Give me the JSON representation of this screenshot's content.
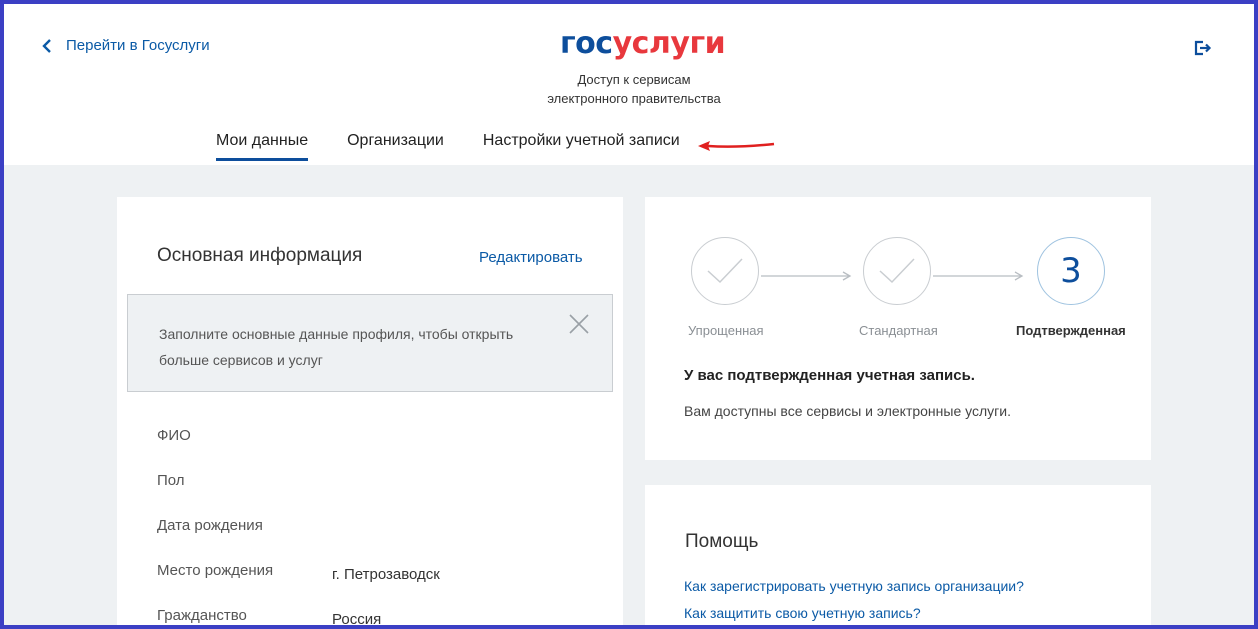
{
  "header": {
    "back_label": "Перейти в Госуслуги",
    "logo_part1": "гос",
    "logo_part2": "услуги",
    "tagline_line1": "Доступ к сервисам",
    "tagline_line2": "электронного правительства",
    "tabs": [
      {
        "label": "Мои данные",
        "active": true
      },
      {
        "label": "Организации",
        "active": false
      },
      {
        "label": "Настройки учетной записи",
        "active": false
      }
    ]
  },
  "main_info": {
    "title": "Основная информация",
    "edit_label": "Редактировать",
    "notice": "Заполните основные данные профиля, чтобы открыть больше сервисов и услуг",
    "fields": [
      {
        "label": "ФИО",
        "value": ""
      },
      {
        "label": "Пол",
        "value": ""
      },
      {
        "label": "Дата рождения",
        "value": ""
      },
      {
        "label": "Место рождения",
        "value": "г. Петрозаводск"
      },
      {
        "label": "Гражданство",
        "value": "Россия"
      }
    ]
  },
  "account_status": {
    "steps": [
      {
        "label": "Упрощенная",
        "state": "done"
      },
      {
        "label": "Стандартная",
        "state": "done"
      },
      {
        "label": "Подтвержденная",
        "state": "current",
        "number": "3"
      }
    ],
    "title": "У вас подтвержденная учетная запись.",
    "description": "Вам доступны все сервисы и электронные услуги."
  },
  "help": {
    "title": "Помощь",
    "links": [
      "Как зарегистрировать учетную запись организации?",
      "Как защитить свою учетную запись?"
    ]
  },
  "colors": {
    "frame": "#3b3fc4",
    "brand_blue": "#0d4e9c",
    "brand_red": "#e8383d",
    "link": "#0b5aa6",
    "annotation_arrow": "#e0201f"
  }
}
